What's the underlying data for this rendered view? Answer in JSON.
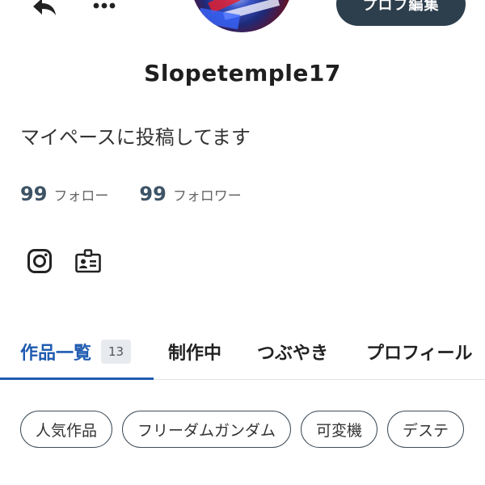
{
  "header": {
    "edit_profile_label": "プロフ編集"
  },
  "profile": {
    "username": "Slopetemple17",
    "bio": "マイペースに投稿してます",
    "stats": [
      {
        "count": "99",
        "label": "フォロー"
      },
      {
        "count": "99",
        "label": "フォロワー"
      }
    ],
    "links": [
      {
        "icon": "instagram-icon"
      },
      {
        "icon": "id-card-icon"
      }
    ]
  },
  "tabs": [
    {
      "label": "作品一覧",
      "count": "13",
      "active": true
    },
    {
      "label": "制作中",
      "active": false
    },
    {
      "label": "つぶやき",
      "active": false
    },
    {
      "label": "プロフィール",
      "active": false
    }
  ],
  "tags": [
    "人気作品",
    "フリーダムガンダム",
    "可変機",
    "デステ"
  ],
  "colors": {
    "accent": "#1f5bb0",
    "edit_button_bg": "#2d3e4c",
    "stat_number": "#3d5366"
  }
}
